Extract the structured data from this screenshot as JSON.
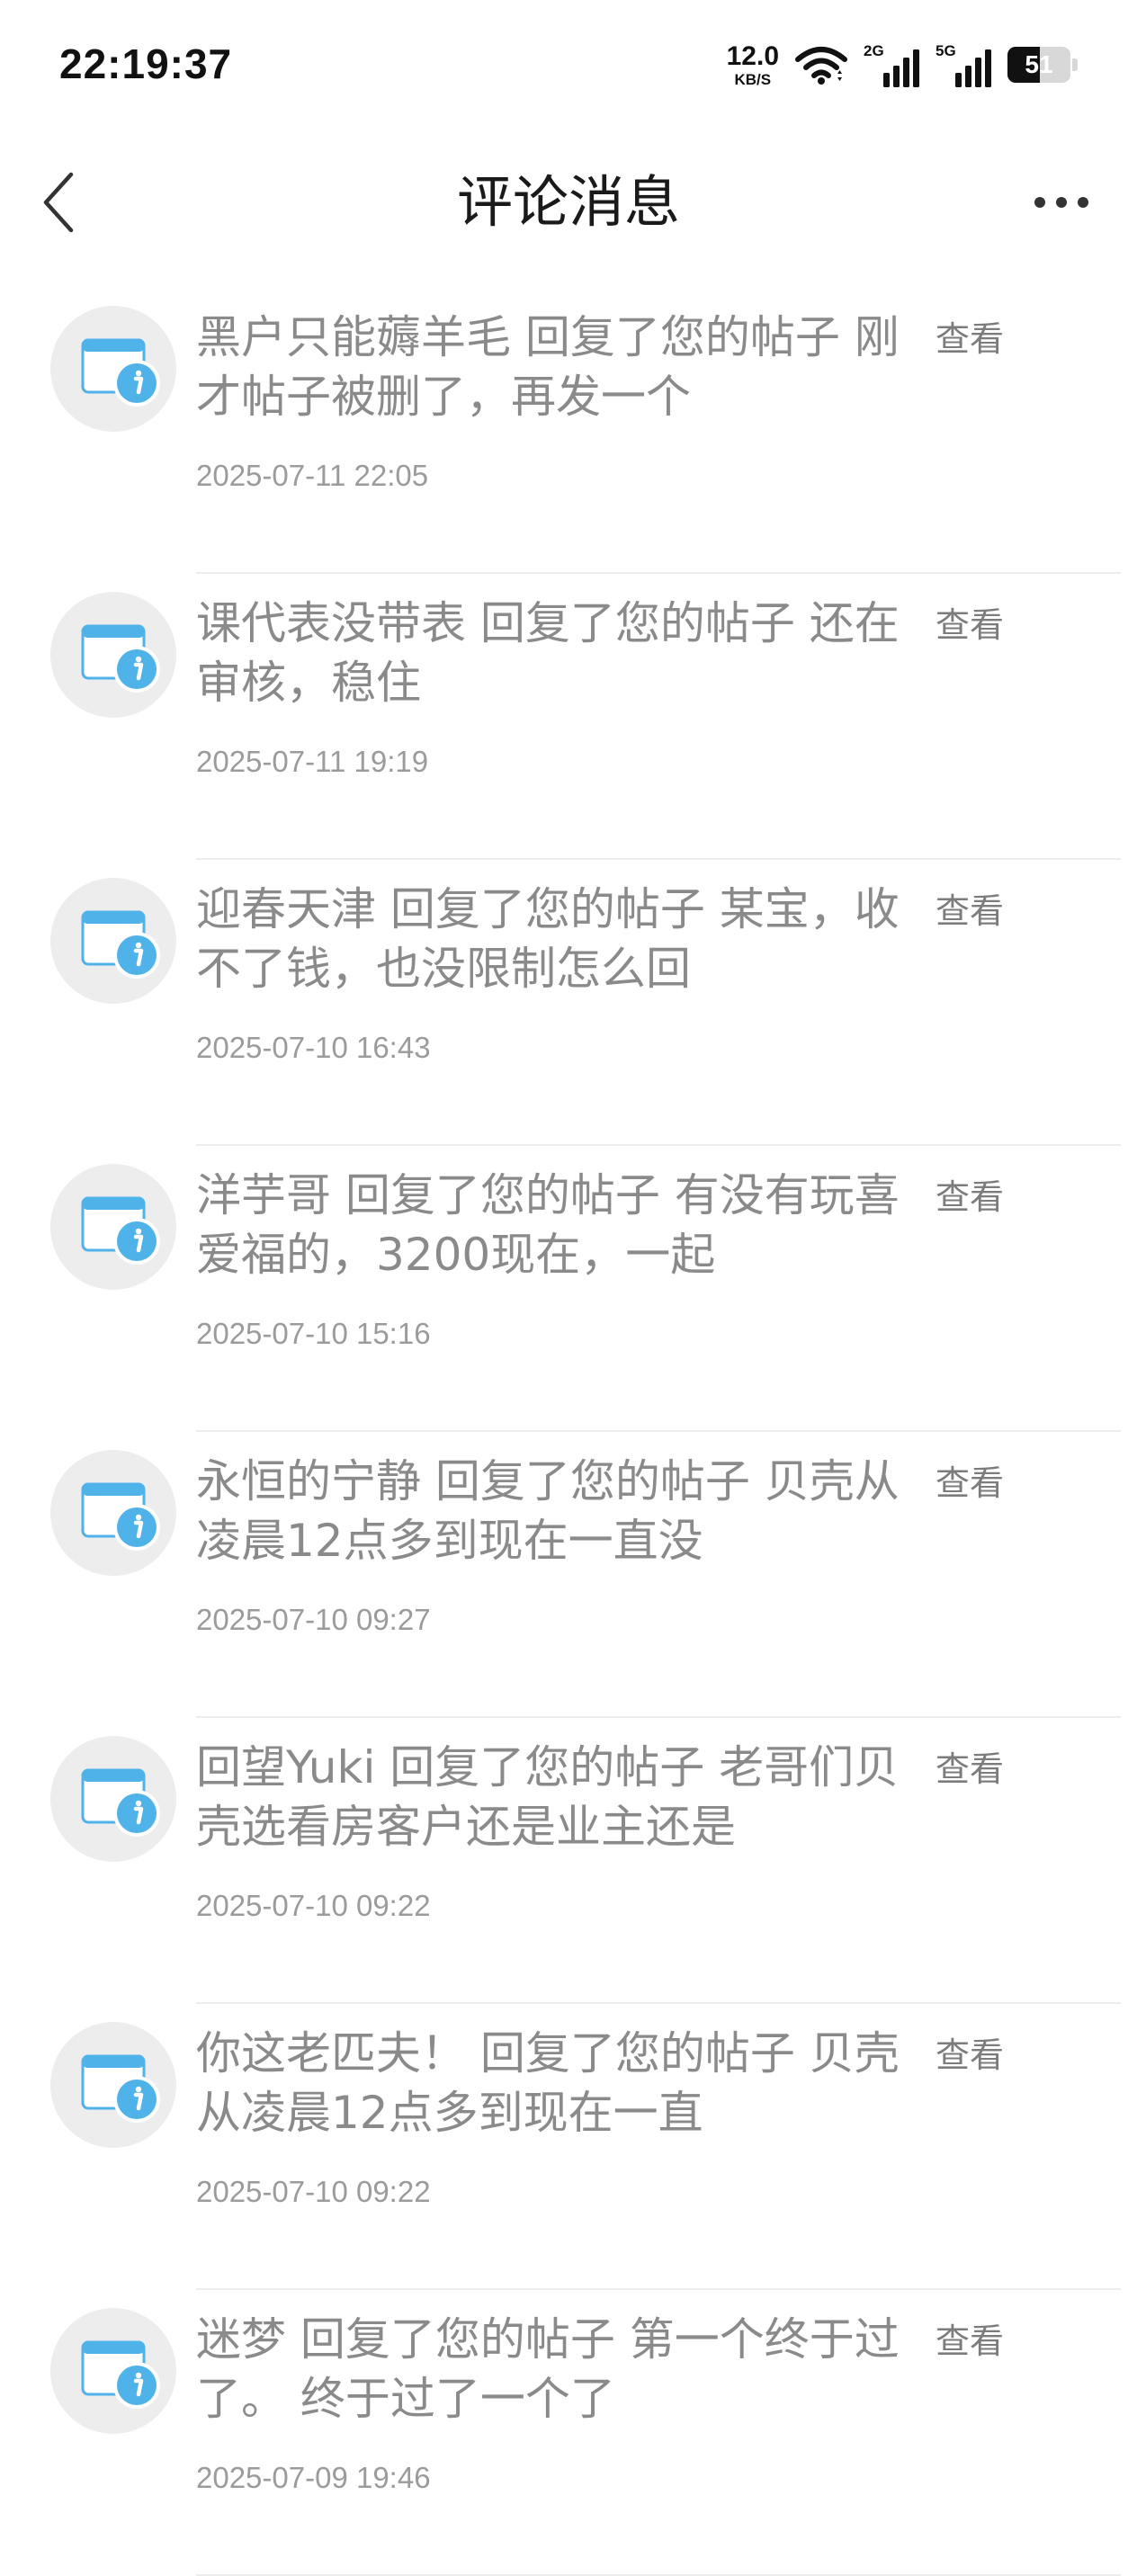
{
  "status_bar": {
    "time": "22:19:37",
    "net_speed": "12.0",
    "net_speed_unit": "KB/S",
    "sim1_type": "2G",
    "sim2_type": "5G",
    "battery_level": "51",
    "battery_fraction": 0.51
  },
  "header": {
    "title": "评论消息",
    "back_icon": "chevron-left-icon",
    "more_icon": "more-dots-icon"
  },
  "colors": {
    "avatar_bg": "#ededed",
    "icon_blue": "#4fb3ea",
    "text_gray": "#8a8a8a"
  },
  "messages": [
    {
      "text": "黑户只能薅羊毛 回复了您的帖子 刚才帖子被删了，再发一个",
      "time": "2025-07-11 22:05",
      "action": "查看"
    },
    {
      "text": "课代表没带表 回复了您的帖子 还在审核，稳住",
      "time": "2025-07-11 19:19",
      "action": "查看"
    },
    {
      "text": "迎春天津 回复了您的帖子 某宝，收不了钱，也没限制怎么回",
      "time": "2025-07-10 16:43",
      "action": "查看"
    },
    {
      "text": "洋芋哥 回复了您的帖子 有没有玩喜爱福的，3200现在，一起",
      "time": "2025-07-10 15:16",
      "action": "查看"
    },
    {
      "text": "永恒的宁静 回复了您的帖子 贝壳从凌晨12点多到现在一直没",
      "time": "2025-07-10 09:27",
      "action": "查看"
    },
    {
      "text": "回望Yuki 回复了您的帖子 老哥们贝壳选看房客户还是业主还是",
      "time": "2025-07-10 09:22",
      "action": "查看"
    },
    {
      "text": "你这老匹夫！ 回复了您的帖子 贝壳从凌晨12点多到现在一直",
      "time": "2025-07-10 09:22",
      "action": "查看"
    },
    {
      "text": "迷梦 回复了您的帖子 第一个终于过了。 终于过了一个了",
      "time": "2025-07-09 19:46",
      "action": "查看"
    }
  ]
}
